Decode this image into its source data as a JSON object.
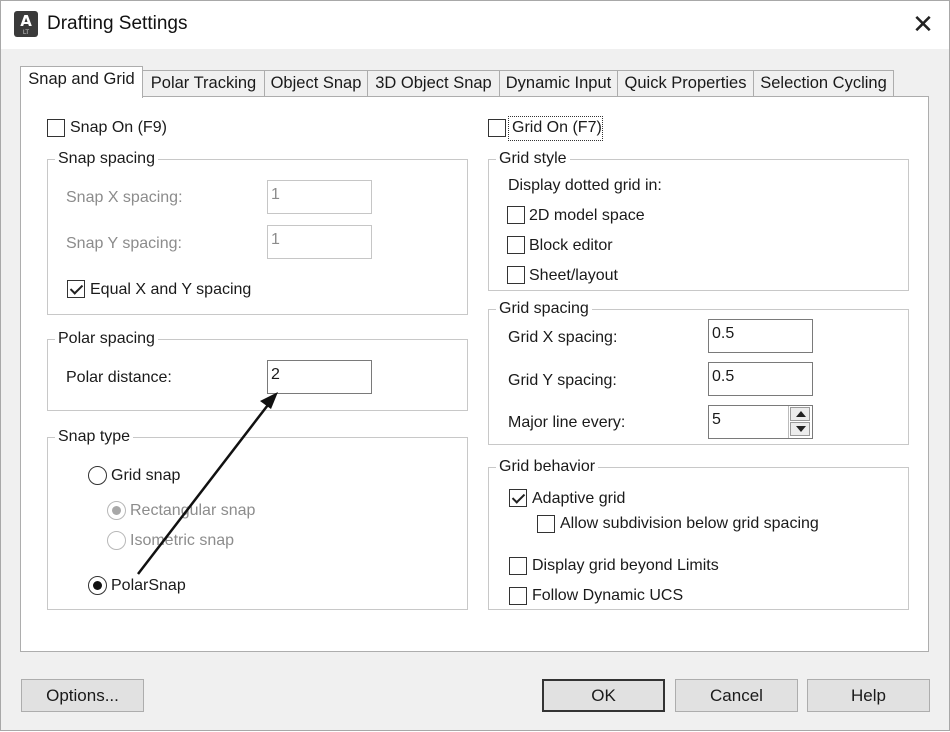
{
  "window": {
    "title": "Drafting Settings",
    "app_icon_letter": "A",
    "app_icon_sub": "LT"
  },
  "tabs": [
    {
      "label": "Snap and Grid",
      "active": true
    },
    {
      "label": "Polar Tracking"
    },
    {
      "label": "Object Snap"
    },
    {
      "label": "3D Object Snap"
    },
    {
      "label": "Dynamic Input"
    },
    {
      "label": "Quick Properties"
    },
    {
      "label": "Selection Cycling"
    }
  ],
  "snap_on": {
    "label": "Snap On (F9)",
    "checked": false
  },
  "grid_on": {
    "label": "Grid On (F7)",
    "checked": false
  },
  "snap_spacing": {
    "title": "Snap spacing",
    "x_label": "Snap X spacing:",
    "x_value": "1",
    "y_label": "Snap Y spacing:",
    "y_value": "1",
    "equal_label": "Equal X and Y spacing",
    "equal_checked": true
  },
  "polar_spacing": {
    "title": "Polar spacing",
    "distance_label": "Polar distance:",
    "distance_value": "2"
  },
  "snap_type": {
    "title": "Snap type",
    "grid_snap": "Grid snap",
    "rectangular_snap": "Rectangular snap",
    "isometric_snap": "Isometric snap",
    "polar_snap": "PolarSnap",
    "selected": "PolarSnap"
  },
  "grid_style": {
    "title": "Grid style",
    "caption": "Display dotted grid in:",
    "model_space": "2D model space",
    "block_editor": "Block editor",
    "sheet_layout": "Sheet/layout"
  },
  "grid_spacing": {
    "title": "Grid spacing",
    "x_label": "Grid X spacing:",
    "x_value": "0.5",
    "y_label": "Grid Y spacing:",
    "y_value": "0.5",
    "major_label": "Major line every:",
    "major_value": "5"
  },
  "grid_behavior": {
    "title": "Grid behavior",
    "adaptive": "Adaptive grid",
    "adaptive_checked": true,
    "subdivision": "Allow subdivision below grid spacing",
    "beyond_limits": "Display grid beyond Limits",
    "follow_ucs": "Follow Dynamic UCS"
  },
  "buttons": {
    "options": "Options...",
    "ok": "OK",
    "cancel": "Cancel",
    "help": "Help"
  }
}
